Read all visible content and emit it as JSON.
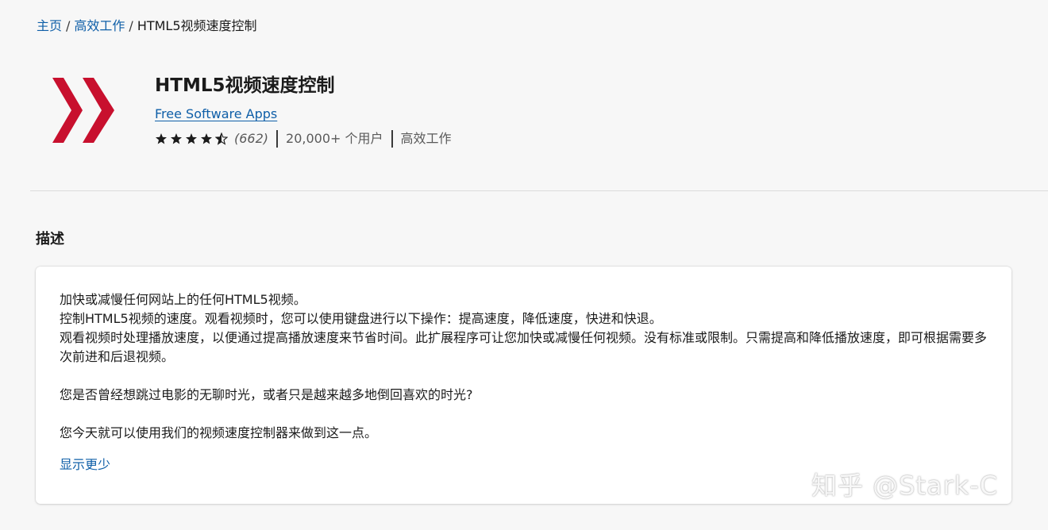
{
  "breadcrumb": {
    "home": "主页",
    "category": "高效工作",
    "current": "HTML5视频速度控制",
    "separator": "/"
  },
  "extension": {
    "logo_icon": "red-double-chevron-icon",
    "logo_color": "#c8102e",
    "title": "HTML5视频速度控制",
    "publisher": "Free Software Apps",
    "rating_stars": 4.5,
    "rating_count": "(662)",
    "users": "20,000+ 个用户",
    "category": "高效工作"
  },
  "description": {
    "heading": "描述",
    "paragraphs": [
      "加快或减慢任何网站上的任何HTML5视频。",
      "控制HTML5视频的速度。观看视频时，您可以使用键盘进行以下操作：提高速度，降低速度，快进和快退。",
      "观看视频时处理播放速度，以便通过提高播放速度来节省时间。此扩展程序可让您加快或减慢任何视频。没有标准或限制。只需提高和降低播放速度，即可根据需要多次前进和后退视频。",
      "您是否曾经想跳过电影的无聊时光，或者只是越来越多地倒回喜欢的时光?",
      "您今天就可以使用我们的视频速度控制器来做到这一点。"
    ],
    "show_less": "显示更少"
  },
  "watermark": "知乎 @Stark-C",
  "colors": {
    "link": "#0f5fa8",
    "background": "#f7f7f7",
    "card": "#ffffff"
  }
}
